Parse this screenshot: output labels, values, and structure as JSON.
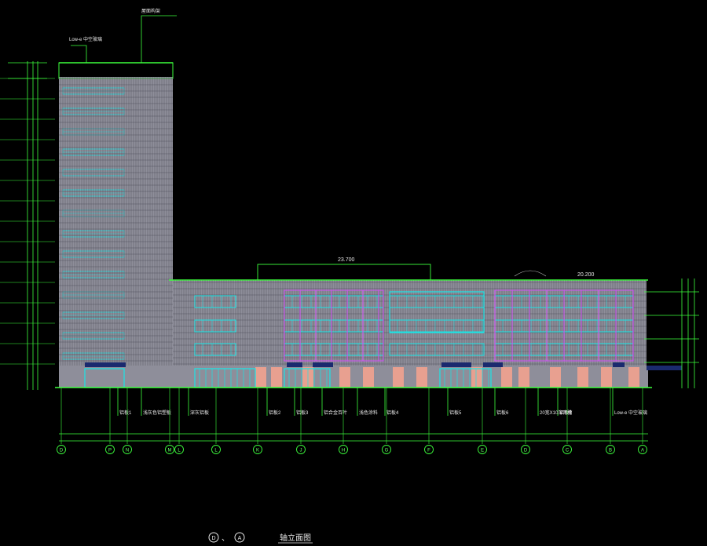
{
  "title": {
    "axis_from": "D",
    "sep": "、",
    "axis_to": "A",
    "name": "轴立面图"
  },
  "dimensions": {
    "top": "23.700",
    "right": "20.200"
  },
  "tower_labels": {
    "roof_top": "屋面构架",
    "glass": "Low-e 中空玻璃"
  },
  "annotations": [
    "铝板1",
    "浅灰色铝塑板",
    "深灰铝板",
    "铝板2",
    "铝板3",
    "铝合金百叶",
    "浅色涂料",
    "铝板4",
    "铝板5",
    "铝板6",
    "20宽X10深凹槽",
    "铝板5",
    "Low-e 中空玻璃"
  ],
  "axis_letters": [
    "D",
    "P",
    "N",
    "M",
    "L",
    "L",
    "K",
    "J",
    "H",
    "G",
    "F",
    "E",
    "D",
    "C",
    "B",
    "A"
  ],
  "colors": {
    "background": "#000000",
    "facade": "#8e8e9a",
    "line_green": "#3cff3c",
    "window_cyan": "#19e6e6",
    "frame_magenta": "#cc55ee",
    "base_salmon": "#e8a090",
    "canopy_navy": "#1a2a6e"
  }
}
